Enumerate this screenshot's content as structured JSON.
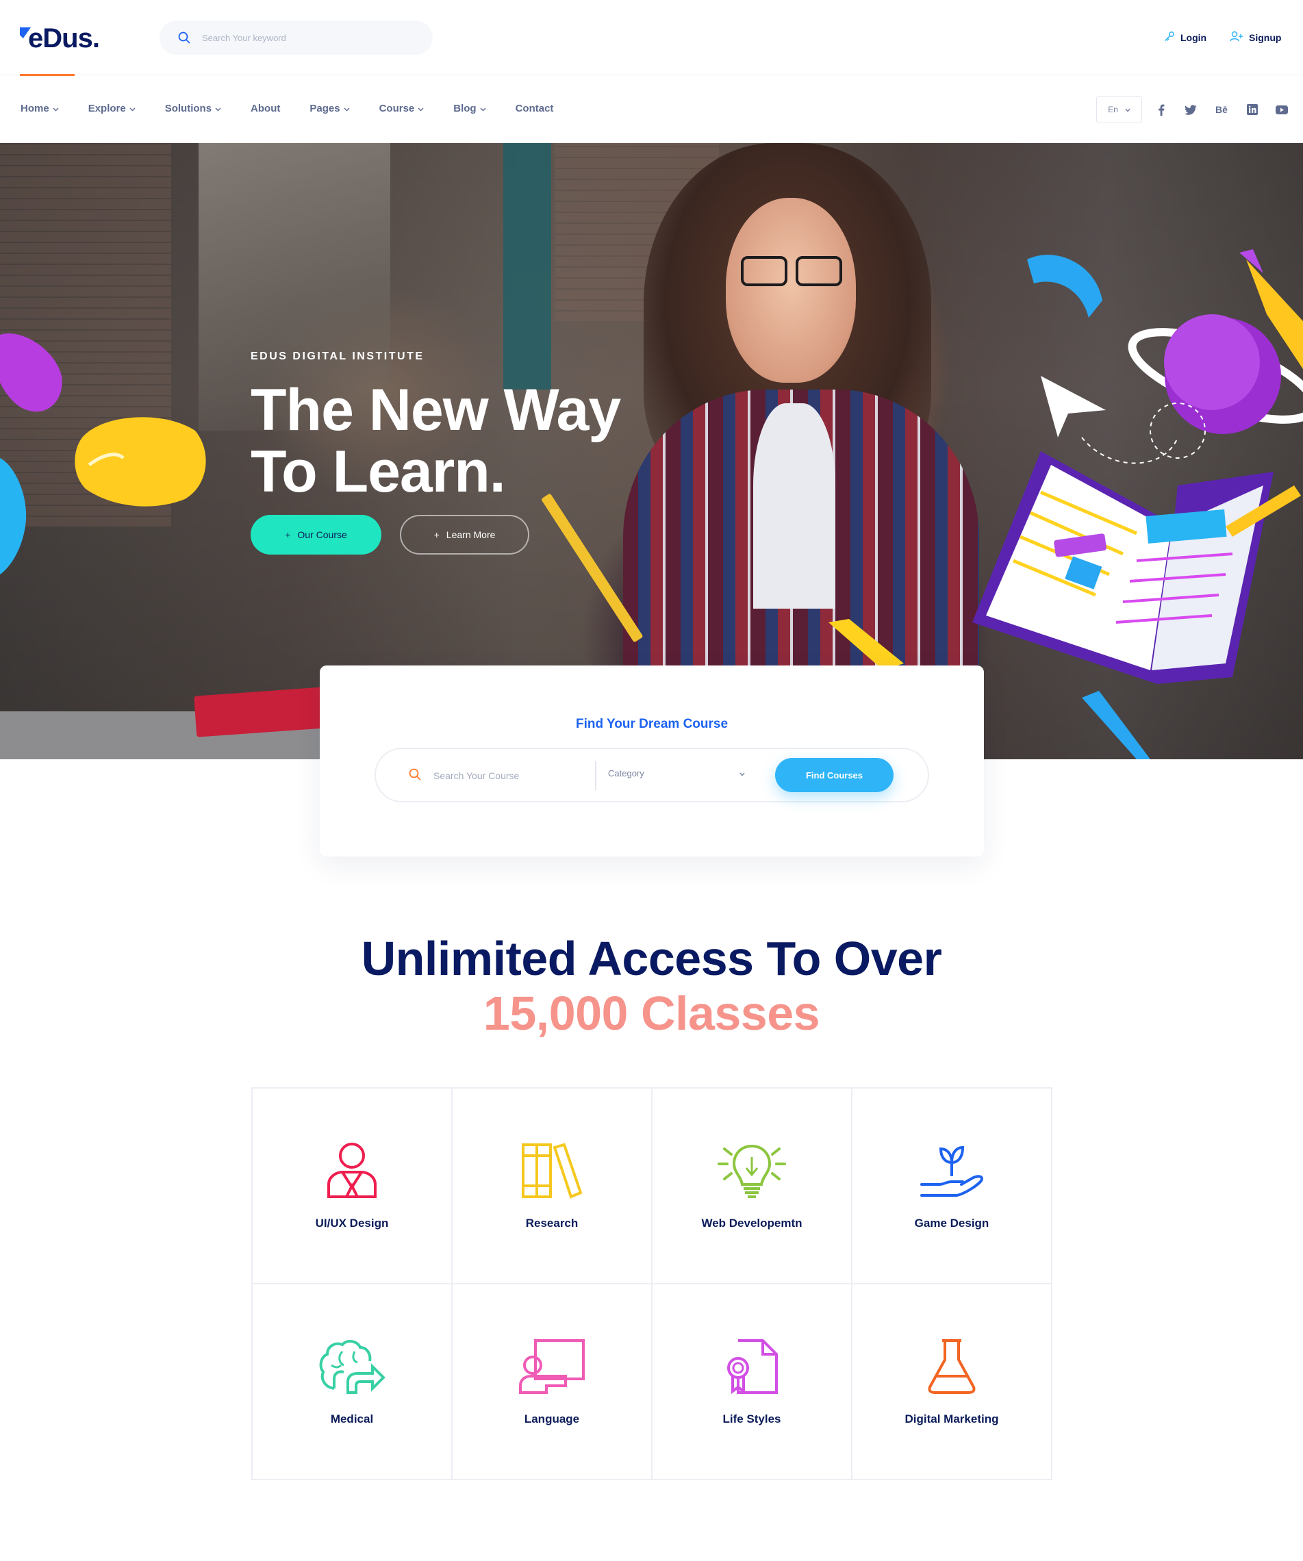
{
  "header": {
    "logo_text": "eDus.",
    "search_placeholder": "Search Your keyword",
    "login_label": "Login",
    "signup_label": "Signup"
  },
  "nav": {
    "items": [
      {
        "label": "Home",
        "dropdown": true
      },
      {
        "label": "Explore",
        "dropdown": true
      },
      {
        "label": "Solutions",
        "dropdown": true
      },
      {
        "label": "About",
        "dropdown": false
      },
      {
        "label": "Pages",
        "dropdown": true
      },
      {
        "label": "Course",
        "dropdown": true
      },
      {
        "label": "Blog",
        "dropdown": true
      },
      {
        "label": "Contact",
        "dropdown": false
      }
    ],
    "language": "En",
    "socials": [
      "facebook-icon",
      "twitter-icon",
      "behance-icon",
      "linkedin-icon",
      "youtube-icon"
    ],
    "behance_text": "Bē"
  },
  "hero": {
    "eyebrow": "EDUS DIGITAL INSTITUTE",
    "title_line1": "The New Way",
    "title_line2": "To Learn.",
    "primary_button": "Our Course",
    "secondary_button": "Learn More"
  },
  "finder": {
    "title": "Find Your Dream Course",
    "search_placeholder": "Search Your Course",
    "category_label": "Category",
    "button_label": "Find Courses"
  },
  "access": {
    "title": "Unlimited Access To Over",
    "subtitle": "15,000 Classes"
  },
  "categories": [
    {
      "label": "UI/UX Design",
      "icon": "designer-person-icon",
      "color": "#ee1f4f"
    },
    {
      "label": "Research",
      "icon": "books-icon",
      "color": "#f6c81f"
    },
    {
      "label": "Web Developemtn",
      "icon": "lightbulb-icon",
      "color": "#8cc63f"
    },
    {
      "label": "Game Design",
      "icon": "plant-hand-icon",
      "color": "#1d63f0"
    },
    {
      "label": "Medical",
      "icon": "brain-arrow-icon",
      "color": "#38d0a4"
    },
    {
      "label": "Language",
      "icon": "teacher-board-icon",
      "color": "#f05bb5"
    },
    {
      "label": "Life Styles",
      "icon": "certificate-icon",
      "color": "#d24fe4"
    },
    {
      "label": "Digital Marketing",
      "icon": "flask-icon",
      "color": "#f26522"
    }
  ],
  "colors": {
    "brand_navy": "#0a1a62",
    "brand_blue": "#1d63f0",
    "accent_orange": "#ff7a2f",
    "hero_button": "#1fe6c0",
    "find_button": "#2fb5f7",
    "subtitle_coral": "#f6948c"
  }
}
